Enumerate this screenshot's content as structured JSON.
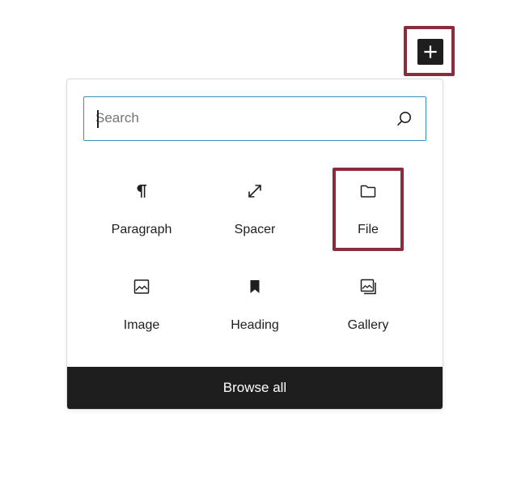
{
  "toolbar": {
    "add_icon": "plus-icon"
  },
  "search": {
    "value": "",
    "placeholder": "Search",
    "icon": "search-icon"
  },
  "blocks": [
    {
      "label": "Paragraph",
      "icon": "paragraph-icon"
    },
    {
      "label": "Spacer",
      "icon": "resize-arrows-icon"
    },
    {
      "label": "File",
      "icon": "folder-icon"
    },
    {
      "label": "Image",
      "icon": "image-icon"
    },
    {
      "label": "Heading",
      "icon": "bookmark-icon"
    },
    {
      "label": "Gallery",
      "icon": "gallery-icon"
    }
  ],
  "browse_all_label": "Browse all",
  "colors": {
    "highlight": "#8a2c3c",
    "focus": "#3a8fb7",
    "dark": "#1e1e1e"
  }
}
